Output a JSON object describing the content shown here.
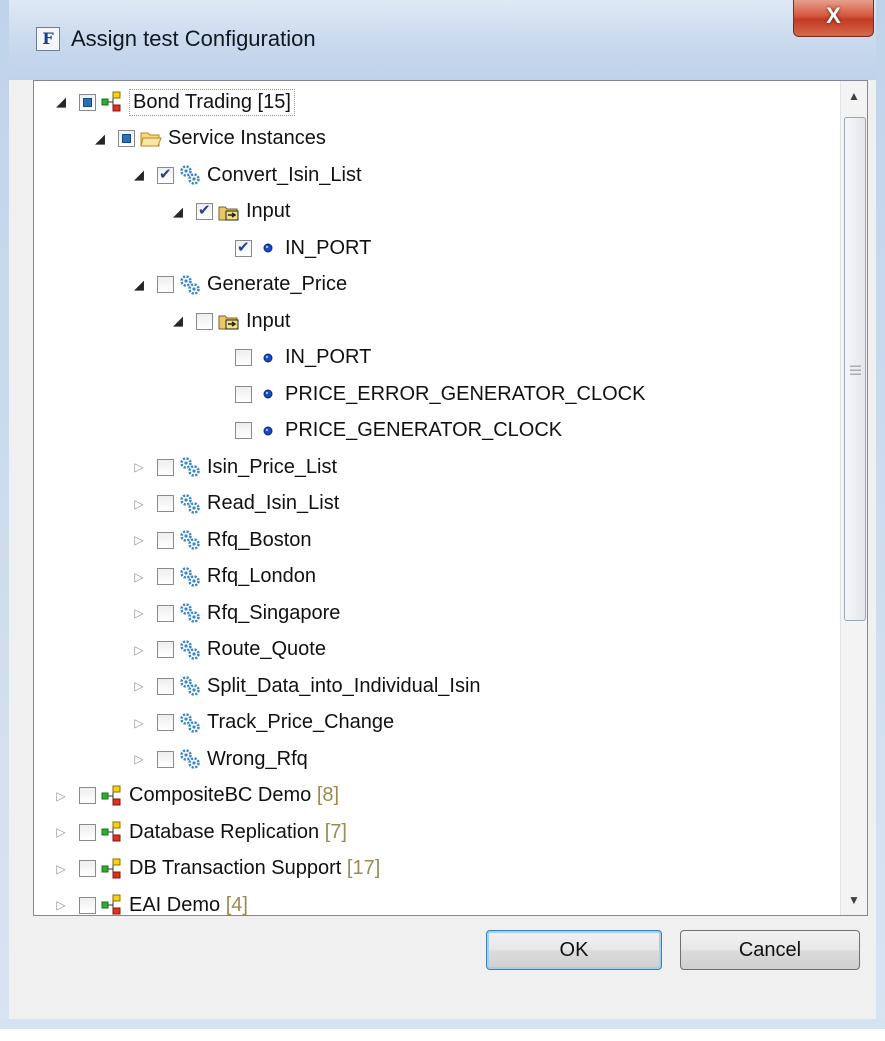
{
  "window": {
    "title": "Assign test Configuration",
    "app_icon": "F",
    "close_label": "X"
  },
  "tree": {
    "rows": [
      {
        "name": "Bond Trading",
        "count": "[15]",
        "type": "project",
        "level": 0,
        "expanded": true,
        "checked": "partial",
        "selected": true
      },
      {
        "name": "Service Instances",
        "count": "",
        "type": "folder",
        "level": 1,
        "expanded": true,
        "checked": "partial"
      },
      {
        "name": "Convert_Isin_List",
        "count": "",
        "type": "service",
        "level": 2,
        "expanded": true,
        "checked": "checked"
      },
      {
        "name": "Input",
        "count": "",
        "type": "input",
        "level": 3,
        "expanded": true,
        "checked": "checked"
      },
      {
        "name": "IN_PORT",
        "count": "",
        "type": "port",
        "level": 4,
        "expanded": null,
        "checked": "checked"
      },
      {
        "name": "Generate_Price",
        "count": "",
        "type": "service",
        "level": 2,
        "expanded": true,
        "checked": "unchecked"
      },
      {
        "name": "Input",
        "count": "",
        "type": "input",
        "level": 3,
        "expanded": true,
        "checked": "unchecked"
      },
      {
        "name": "IN_PORT",
        "count": "",
        "type": "port",
        "level": 4,
        "expanded": null,
        "checked": "unchecked"
      },
      {
        "name": "PRICE_ERROR_GENERATOR_CLOCK",
        "count": "",
        "type": "port",
        "level": 4,
        "expanded": null,
        "checked": "unchecked"
      },
      {
        "name": "PRICE_GENERATOR_CLOCK",
        "count": "",
        "type": "port",
        "level": 4,
        "expanded": null,
        "checked": "unchecked"
      },
      {
        "name": "Isin_Price_List",
        "count": "",
        "type": "service",
        "level": 2,
        "expanded": false,
        "checked": "unchecked"
      },
      {
        "name": "Read_Isin_List",
        "count": "",
        "type": "service",
        "level": 2,
        "expanded": false,
        "checked": "unchecked"
      },
      {
        "name": "Rfq_Boston",
        "count": "",
        "type": "service",
        "level": 2,
        "expanded": false,
        "checked": "unchecked"
      },
      {
        "name": "Rfq_London",
        "count": "",
        "type": "service",
        "level": 2,
        "expanded": false,
        "checked": "unchecked"
      },
      {
        "name": "Rfq_Singapore",
        "count": "",
        "type": "service",
        "level": 2,
        "expanded": false,
        "checked": "unchecked"
      },
      {
        "name": "Route_Quote",
        "count": "",
        "type": "service",
        "level": 2,
        "expanded": false,
        "checked": "unchecked"
      },
      {
        "name": "Split_Data_into_Individual_Isin",
        "count": "",
        "type": "service",
        "level": 2,
        "expanded": false,
        "checked": "unchecked"
      },
      {
        "name": "Track_Price_Change",
        "count": "",
        "type": "service",
        "level": 2,
        "expanded": false,
        "checked": "unchecked"
      },
      {
        "name": "Wrong_Rfq",
        "count": "",
        "type": "service",
        "level": 2,
        "expanded": false,
        "checked": "unchecked"
      },
      {
        "name": "CompositeBC Demo",
        "count": "[8]",
        "type": "project",
        "level": 0,
        "expanded": false,
        "checked": "unchecked"
      },
      {
        "name": "Database Replication",
        "count": "[7]",
        "type": "project",
        "level": 0,
        "expanded": false,
        "checked": "unchecked"
      },
      {
        "name": "DB Transaction Support",
        "count": "[17]",
        "type": "project",
        "level": 0,
        "expanded": false,
        "checked": "unchecked"
      },
      {
        "name": "EAI Demo",
        "count": "[4]",
        "type": "project",
        "level": 0,
        "expanded": false,
        "checked": "unchecked"
      }
    ]
  },
  "buttons": {
    "ok_label": "OK",
    "cancel_label": "Cancel"
  },
  "colors": {
    "count_text": "#9c8a4e",
    "checkbox_check": "#2a3f87",
    "partial_fill": "#2b6fb8",
    "gear": "#3a86c8",
    "port_dot": "#1848c8"
  }
}
